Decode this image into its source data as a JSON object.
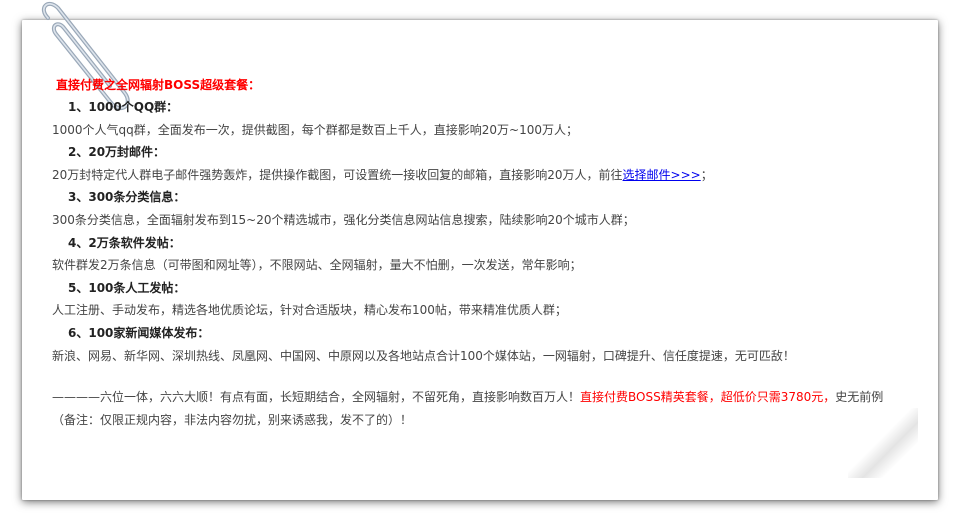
{
  "headline": "直接付费之全网辐射BOSS超级套餐：",
  "sections": [
    {
      "title": "1、1000个QQ群：",
      "body": "1000个人气qq群，全面发布一次，提供截图，每个群都是数百上千人，直接影响20万~100万人；"
    },
    {
      "title": "2、20万封邮件：",
      "body_before": "20万封特定代人群电子邮件强势轰炸，提供操作截图，可设置统一接收回复的邮箱，直接影响20万人，前往",
      "link": "选择邮件>>>",
      "body_after": "；"
    },
    {
      "title": "3、300条分类信息：",
      "body": "300条分类信息，全面辐射发布到15~20个精选城市，强化分类信息网站信息搜索，陆续影响20个城市人群；"
    },
    {
      "title": "4、2万条软件发帖：",
      "body": "软件群发2万条信息（可带图和网址等），不限网站、全网辐射，量大不怕删，一次发送，常年影响；"
    },
    {
      "title": "5、100条人工发帖：",
      "body": "人工注册、手动发布，精选各地优质论坛，针对合适版块，精心发布100帖，带来精准优质人群；"
    },
    {
      "title": "6、100家新闻媒体发布：",
      "body": "新浪、网易、新华网、深圳热线、凤凰网、中国网、中原网以及各地站点合计100个媒体站，一网辐射，口碑提升、信任度提速，无可匹敌！"
    }
  ],
  "closing": {
    "part1": "————六位一体，六六大顺！有点有面，长短期结合，全网辐射，不留死角，直接影响数百万人！",
    "red": "直接付费BOSS精英套餐，超低价只需3780元，",
    "part2": "史无前例（备注：仅限正规内容，非法内容勿扰，别来诱惑我，发不了的）！"
  },
  "colors": {
    "accent_red": "#ff0000",
    "link_blue": "#0000ee",
    "body_text": "#444444"
  },
  "icons": {
    "paperclip": "paperclip-icon"
  }
}
